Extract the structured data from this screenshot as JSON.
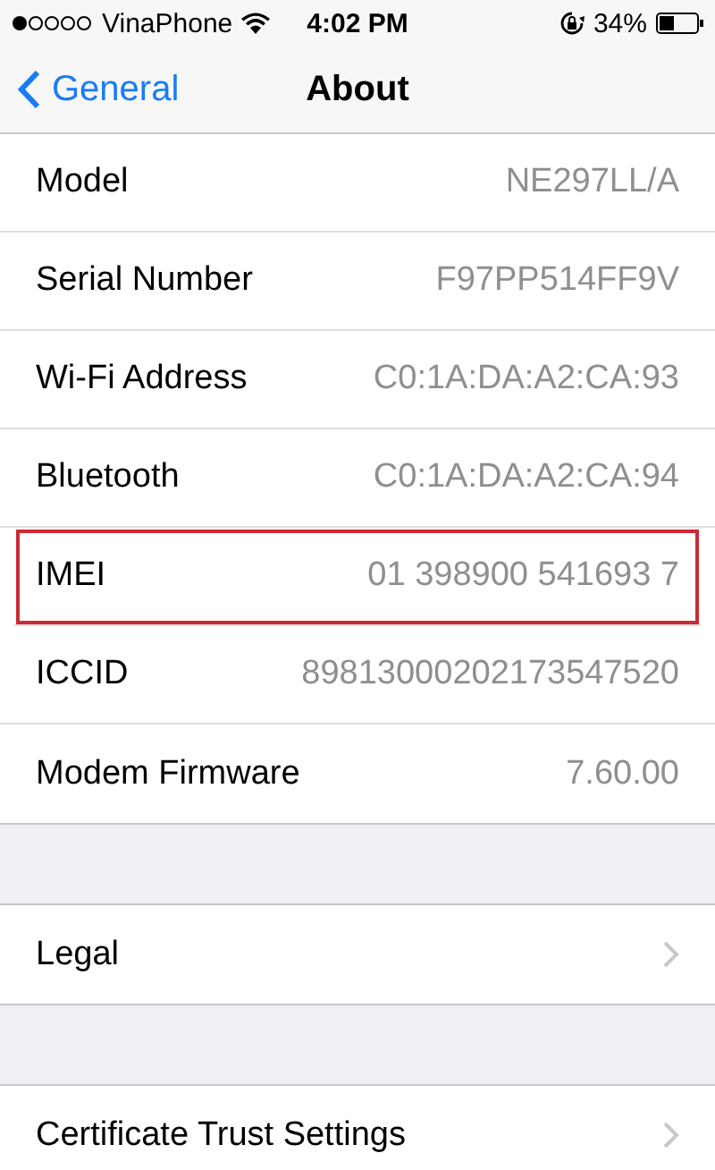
{
  "status_bar": {
    "carrier": "VinaPhone",
    "time": "4:02 PM",
    "battery": "34%"
  },
  "nav": {
    "back": "General",
    "title": "About"
  },
  "groups": [
    {
      "rows": [
        {
          "label": "Model",
          "value": "NE297LL/A",
          "highlighted": false
        },
        {
          "label": "Serial Number",
          "value": "F97PP514FF9V",
          "highlighted": false
        },
        {
          "label": "Wi-Fi Address",
          "value": "C0:1A:DA:A2:CA:93",
          "highlighted": false
        },
        {
          "label": "Bluetooth",
          "value": "C0:1A:DA:A2:CA:94",
          "highlighted": false
        },
        {
          "label": "IMEI",
          "value": "01 398900 541693 7",
          "highlighted": true
        },
        {
          "label": "ICCID",
          "value": "89813000202173547520",
          "highlighted": false
        },
        {
          "label": "Modem Firmware",
          "value": "7.60.00",
          "highlighted": false
        }
      ]
    },
    {
      "rows": [
        {
          "label": "Legal",
          "kind": "link"
        }
      ]
    },
    {
      "rows": [
        {
          "label": "Certificate Trust Settings",
          "kind": "link"
        }
      ]
    }
  ]
}
